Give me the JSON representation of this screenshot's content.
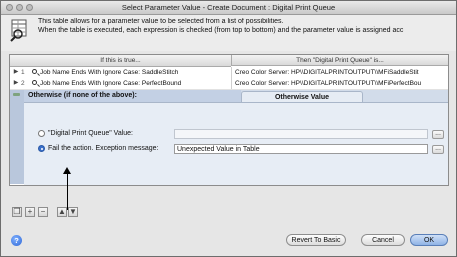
{
  "window": {
    "title": "Select Parameter Value - Create Document : Digital Print Queue"
  },
  "header": {
    "icon": "table-parameter-icon",
    "description_line1": "This table allows for a parameter value to be selected from a list of possibilities.",
    "description_line2": "When the table is executed, each expression is checked (from top to bottom) and the parameter value is assigned acc"
  },
  "table": {
    "columns": [
      "If this is true...",
      "Then \"Digital Print Queue\" is..."
    ],
    "rows": [
      {
        "condition": "Job Name Ends With Ignore Case: SaddleStitch",
        "value": "Creo Color Server: HP\\\\DIGITALPRINTOUTPUT\\\\MFiSaddleStit"
      },
      {
        "condition": "Job Name Ends With Ignore Case: PerfectBound",
        "value": "Creo Color Server: HP\\\\DIGITALPRINTOUTPUT\\\\MFiPerfectBou"
      }
    ],
    "otherwise": {
      "label": "Otherwise (if none of the above):",
      "tab_label": "Otherwise Value",
      "option_value_label": "\"Digital Print Queue\" Value:",
      "option_value_text": "",
      "option_fail_label": "Fail the action.  Exception message:",
      "option_fail_text": "Unexpected Value in Table",
      "browse_label": "..."
    }
  },
  "toolbar": {
    "icons": [
      "copy-row-icon",
      "add-row-icon",
      "remove-row-icon",
      "move-up-icon",
      "move-down-icon"
    ]
  },
  "footer": {
    "help_label": "?",
    "revert_label": "Revert To Basic",
    "cancel_label": "Cancel",
    "ok_label": "OK"
  }
}
